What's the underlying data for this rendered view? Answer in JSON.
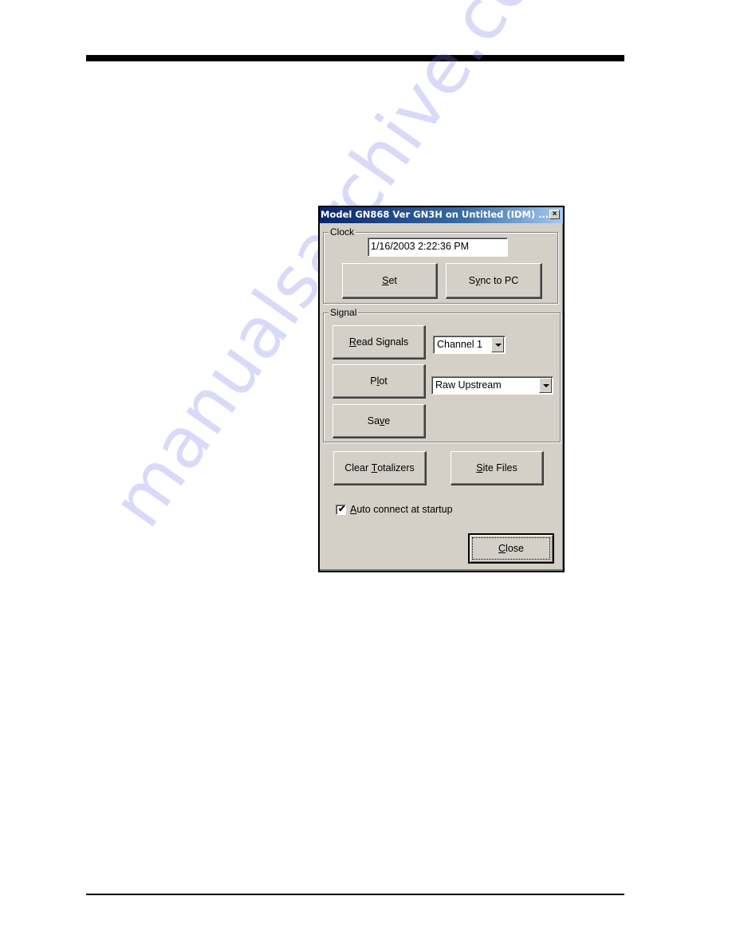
{
  "page": {
    "watermark": "manualsarchive.com"
  },
  "dialog": {
    "title": "Model GN868 Ver GN3H on Untitled (IDM) ...",
    "close_icon": "×",
    "clock": {
      "group_label": "Clock",
      "datetime_value": "1/16/2003 2:22:36 PM",
      "set_button": {
        "pre": "",
        "mnemonic": "S",
        "post": "et"
      },
      "sync_button": {
        "pre": "S",
        "mnemonic": "y",
        "post": "nc to PC"
      }
    },
    "signal": {
      "group_label": "Signal",
      "read_signals_button": {
        "pre": "",
        "mnemonic": "R",
        "post": "ead Signals"
      },
      "plot_button": {
        "pre": "P",
        "mnemonic": "l",
        "post": "ot"
      },
      "save_button": {
        "pre": "Sa",
        "mnemonic": "v",
        "post": "e"
      },
      "channel_select": {
        "selected": "Channel 1"
      },
      "signal_type_select": {
        "selected": "Raw Upstream"
      }
    },
    "clear_totalizers_button": {
      "pre": "Clear ",
      "mnemonic": "T",
      "post": "otalizers"
    },
    "site_files_button": {
      "pre": "",
      "mnemonic": "S",
      "post": "ite Files"
    },
    "auto_connect": {
      "checked": true,
      "check_glyph": "✔",
      "label": {
        "pre": "",
        "mnemonic": "A",
        "post": "uto connect at startup"
      }
    },
    "close_button": {
      "pre": "",
      "mnemonic": "C",
      "post": "lose"
    }
  },
  "colors": {
    "titlebar_start": "#0a246a",
    "titlebar_end": "#a6caf0",
    "dialog_face": "#d4d0c8"
  }
}
